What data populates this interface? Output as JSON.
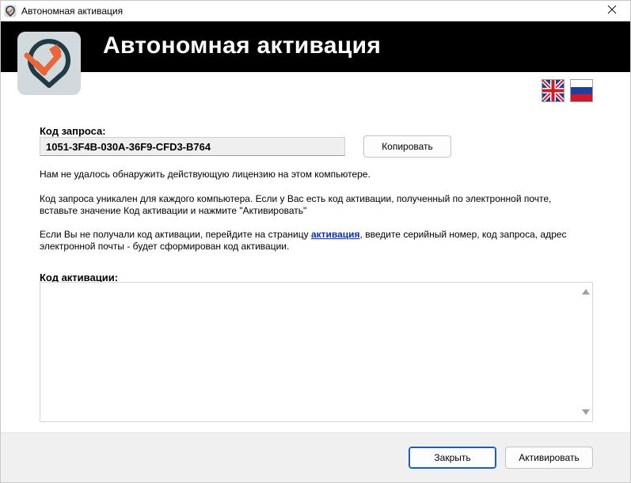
{
  "window": {
    "title": "Автономная активация",
    "close_icon": "close-icon"
  },
  "banner": {
    "title": "Автономная активация",
    "background": "#000000",
    "logo_icon": "activation-logo-icon"
  },
  "languages": [
    {
      "name": "uk-flag-icon"
    },
    {
      "name": "ru-flag-icon"
    }
  ],
  "request": {
    "label": "Код запроса:",
    "value": "1051-3F4B-030A-36F9-CFD3-B764",
    "copy_label": "Копировать"
  },
  "messages": {
    "no_license": "Нам не удалось обнаружить действующую лицензию на этом компьютере.",
    "unique_line1": "Код запроса уникален для каждого компьютера. Если у Вас есть код активации, полученный по электронной почте,",
    "unique_line2": "вставьте значение Код активации и нажмите \"Активировать\"",
    "page_prefix": "Если Вы не получали код активации, перейдите на страницу ",
    "page_link": "активация",
    "page_suffix": ", введите серийный номер, код запроса, адрес",
    "page_line2": "электронной почты - будет сформирован код активации."
  },
  "activation": {
    "label": "Код активации:",
    "value": ""
  },
  "footer": {
    "close_label": "Закрыть",
    "activate_label": "Активировать"
  },
  "colors": {
    "accent": "#1a5fb4",
    "link": "#0a2fb3",
    "logo_orange": "#e8663a",
    "logo_dark": "#1f3b46"
  }
}
